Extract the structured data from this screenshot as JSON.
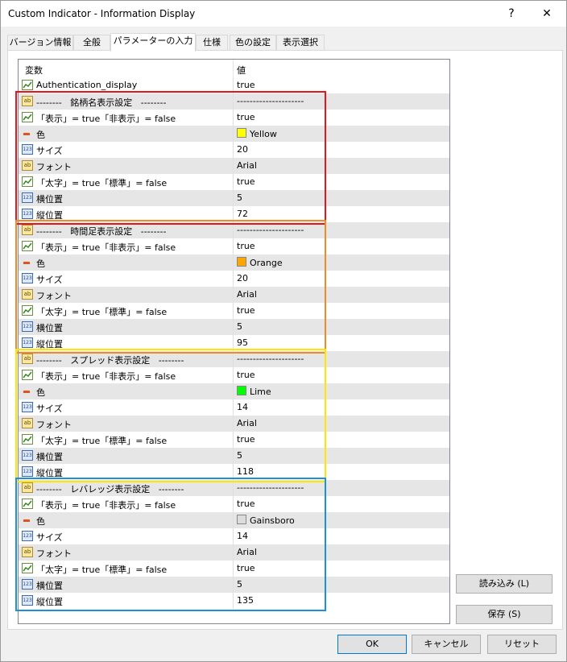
{
  "window": {
    "title": "Custom Indicator - Information Display",
    "help": "?",
    "close": "✕"
  },
  "tabs": [
    {
      "label": "バージョン情報"
    },
    {
      "label": "全般"
    },
    {
      "label": "パラメーターの入力"
    },
    {
      "label": "仕様"
    },
    {
      "label": "色の設定"
    },
    {
      "label": "表示選択"
    }
  ],
  "grid": {
    "col_variable": "変数",
    "col_value": "値",
    "rows": [
      {
        "icon": "bool",
        "name": "Authentication_display",
        "value": "true"
      },
      {
        "icon": "str",
        "name": "--------   銘柄名表示設定   --------",
        "value": "---------------------"
      },
      {
        "icon": "bool",
        "name": "「表示」= true「非表示」= false",
        "value": "true"
      },
      {
        "icon": "color",
        "name": "色",
        "value": "Yellow",
        "color": "#ffff00"
      },
      {
        "icon": "num",
        "name": "サイズ",
        "value": "20"
      },
      {
        "icon": "str",
        "name": "フォント",
        "value": "Arial"
      },
      {
        "icon": "bool",
        "name": "「太字」= true「標準」= false",
        "value": "true"
      },
      {
        "icon": "num",
        "name": "横位置",
        "value": "5"
      },
      {
        "icon": "num",
        "name": "縦位置",
        "value": "72"
      },
      {
        "icon": "str",
        "name": "--------   時間足表示設定   --------",
        "value": "---------------------"
      },
      {
        "icon": "bool",
        "name": "「表示」= true「非表示」= false",
        "value": "true"
      },
      {
        "icon": "color",
        "name": "色",
        "value": "Orange",
        "color": "#ffa500"
      },
      {
        "icon": "num",
        "name": "サイズ",
        "value": "20"
      },
      {
        "icon": "str",
        "name": "フォント",
        "value": "Arial"
      },
      {
        "icon": "bool",
        "name": "「太字」= true「標準」= false",
        "value": "true"
      },
      {
        "icon": "num",
        "name": "横位置",
        "value": "5"
      },
      {
        "icon": "num",
        "name": "縦位置",
        "value": "95"
      },
      {
        "icon": "str",
        "name": "--------   スプレッド表示設定   --------",
        "value": "---------------------"
      },
      {
        "icon": "bool",
        "name": "「表示」= true「非表示」= false",
        "value": "true"
      },
      {
        "icon": "color",
        "name": "色",
        "value": "Lime",
        "color": "#00ff00"
      },
      {
        "icon": "num",
        "name": "サイズ",
        "value": "14"
      },
      {
        "icon": "str",
        "name": "フォント",
        "value": "Arial"
      },
      {
        "icon": "bool",
        "name": "「太字」= true「標準」= false",
        "value": "true"
      },
      {
        "icon": "num",
        "name": "横位置",
        "value": "5"
      },
      {
        "icon": "num",
        "name": "縦位置",
        "value": "118"
      },
      {
        "icon": "str",
        "name": "--------   レバレッジ表示設定   --------",
        "value": "---------------------"
      },
      {
        "icon": "bool",
        "name": "「表示」= true「非表示」= false",
        "value": "true"
      },
      {
        "icon": "color",
        "name": "色",
        "value": "Gainsboro",
        "color": "#dcdcdc"
      },
      {
        "icon": "num",
        "name": "サイズ",
        "value": "14"
      },
      {
        "icon": "str",
        "name": "フォント",
        "value": "Arial"
      },
      {
        "icon": "bool",
        "name": "「太字」= true「標準」= false",
        "value": "true"
      },
      {
        "icon": "num",
        "name": "横位置",
        "value": "5"
      },
      {
        "icon": "num",
        "name": "縦位置",
        "value": "135"
      }
    ]
  },
  "highlight_colors": [
    "#e8141c",
    "#f08a24",
    "#ffe600",
    "#1e90d6"
  ],
  "buttons": {
    "load": "読み込み (L)",
    "save": "保存 (S)",
    "ok": "OK",
    "cancel": "キャンセル",
    "reset": "リセット"
  }
}
